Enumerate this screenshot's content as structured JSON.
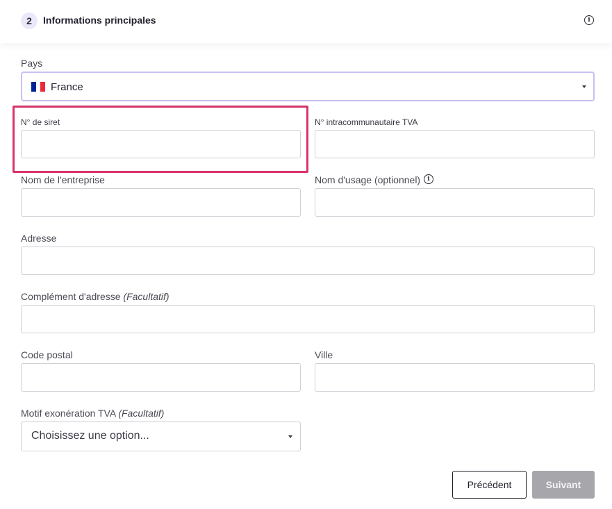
{
  "header": {
    "step_number": "2",
    "title": "Informations principales"
  },
  "country": {
    "label": "Pays",
    "value": "France",
    "flag_colors": [
      "#002395",
      "#ffffff",
      "#ed2939"
    ]
  },
  "siret": {
    "label": "N° de siret",
    "value": ""
  },
  "tva_intra": {
    "label": "N° intracommunautaire TVA",
    "value": ""
  },
  "company_name": {
    "label": "Nom de l'entreprise",
    "value": ""
  },
  "usage_name": {
    "label": "Nom d'usage (optionnel)",
    "value": ""
  },
  "address": {
    "label": "Adresse",
    "value": ""
  },
  "address_complement": {
    "label": "Complément d'adresse",
    "optional": "(Facultatif)",
    "value": ""
  },
  "postal_code": {
    "label": "Code postal",
    "value": ""
  },
  "city": {
    "label": "Ville",
    "value": ""
  },
  "vat_exemption": {
    "label": "Motif exonération TVA",
    "optional": "(Facultatif)",
    "placeholder": "Choisissez une option..."
  },
  "buttons": {
    "previous": "Précédent",
    "next": "Suivant"
  },
  "colors": {
    "highlight": "#d8336a",
    "focus_border": "#c9bff2",
    "badge_bg": "#ece8fb",
    "disabled_button": "#a6a6ab"
  }
}
